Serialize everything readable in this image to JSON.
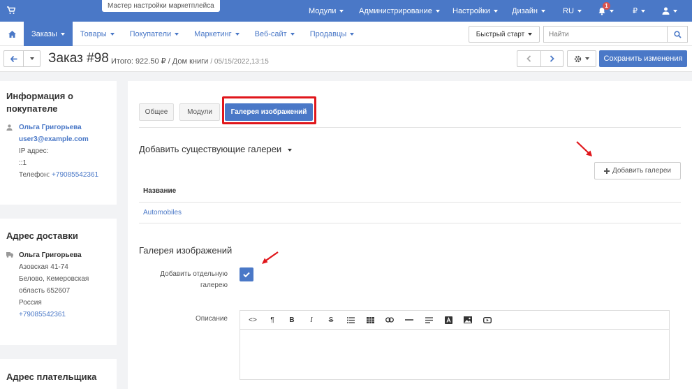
{
  "topbar": {
    "wizard_label": "Мастер настройки маркетплейса",
    "menu": [
      "Модули",
      "Администрирование",
      "Настройки",
      "Дизайн",
      "RU"
    ],
    "notification_count": "1",
    "currency": "₽"
  },
  "subnav": {
    "tabs": [
      "Заказы",
      "Товары",
      "Покупатели",
      "Маркетинг",
      "Веб-сайт",
      "Продавцы"
    ],
    "quickstart_label": "Быстрый старт",
    "search_placeholder": "Найти"
  },
  "titlebar": {
    "title": "Заказ #98",
    "total": "Итого: 922.50 ₽ / Дом книги",
    "date": "/ 05/15/2022,13:15",
    "save_label": "Сохранить изменения"
  },
  "customer": {
    "heading": "Информация о покупателе",
    "name": "Ольга Григорьева",
    "email": "user3@example.com",
    "ip_label": "IP адрес:",
    "ip_value": "::1",
    "phone_label": "Телефон:",
    "phone_value": "+79085542361"
  },
  "shipping": {
    "heading": "Адрес доставки",
    "name": "Ольга Григорьева",
    "line1": "Азовская 41-74",
    "line2": "Белово, Кемеровская",
    "line3": "область 652607",
    "line4": "Россия",
    "phone": "+79085542361"
  },
  "billing": {
    "heading": "Адрес плательщика"
  },
  "content": {
    "tabs": [
      "Общее",
      "Модули",
      "Галерея изображений"
    ],
    "existing_title": "Добавить существующие галереи",
    "add_gallery_label": "Добавить галереи",
    "table_header": "Название",
    "table_rows": [
      "Automobiles"
    ],
    "gallery_title": "Галерея изображений",
    "separate_label_1": "Добавить отдельную",
    "separate_label_2": "галерею",
    "description_label": "Описание",
    "separate_checked": true
  },
  "colors": {
    "primary": "#4a78c7",
    "highlight": "#e0161b"
  }
}
